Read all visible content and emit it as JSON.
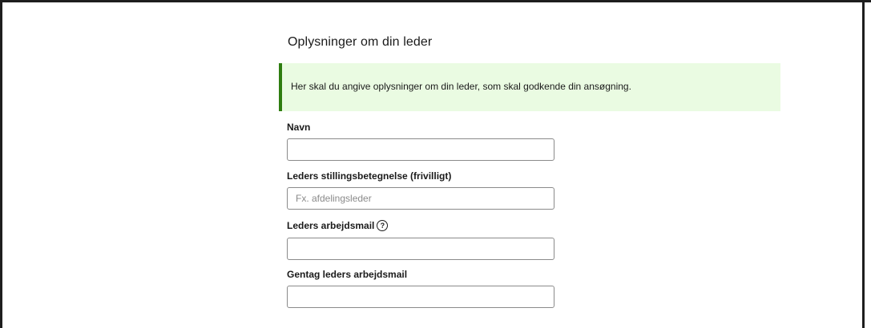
{
  "section": {
    "title": "Oplysninger om din leder",
    "info_text": "Her skal du angive oplysninger om din leder, som skal godkende din ansøgning."
  },
  "fields": {
    "name": {
      "label": "Navn",
      "value": "",
      "placeholder": ""
    },
    "job_title": {
      "label": "Leders stillingsbetegnelse (frivilligt)",
      "value": "",
      "placeholder": "Fx. afdelingsleder"
    },
    "email": {
      "label": "Leders arbejdsmail",
      "help_icon": "?",
      "value": "",
      "placeholder": ""
    },
    "email_repeat": {
      "label": "Gentag leders arbejdsmail",
      "value": "",
      "placeholder": ""
    }
  },
  "colors": {
    "info_background": "#eafbe2",
    "info_accent": "#2e7d10"
  }
}
